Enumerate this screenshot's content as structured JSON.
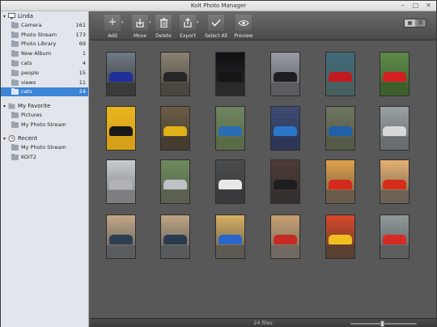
{
  "window": {
    "title": "Koit Photo Manager"
  },
  "sidebar": {
    "user": "Linda",
    "items": [
      {
        "label": "Camera",
        "count": "161"
      },
      {
        "label": "Photo Stream",
        "count": "173"
      },
      {
        "label": "Photo Library",
        "count": "69"
      },
      {
        "label": "New Album",
        "count": "1"
      },
      {
        "label": "cats",
        "count": "4"
      },
      {
        "label": "people",
        "count": "15"
      },
      {
        "label": "views",
        "count": "11"
      },
      {
        "label": "cats",
        "count": "24",
        "selected": true
      }
    ],
    "favorite_title": "My Favorite",
    "favorites": [
      {
        "label": "Pictures"
      },
      {
        "label": "My Photo Stream"
      }
    ],
    "recent_title": "Recent",
    "recent": [
      {
        "label": "My Photo Stream"
      },
      {
        "label": "KOIT2"
      }
    ]
  },
  "toolbar": {
    "add": "Add",
    "move": "Move",
    "delete": "Delete",
    "export": "Export",
    "select_all": "Select All",
    "preview": "Preview"
  },
  "status": {
    "file_count": "24 files",
    "zoom_level": 0.48
  },
  "photos": [
    {
      "sky": "#6f7a86",
      "car": "#1c2f9a",
      "road": "#3a3a3a"
    },
    {
      "sky": "#8a8272",
      "car": "#262626",
      "road": "#4c4640"
    },
    {
      "sky": "#101014",
      "car": "#151515",
      "road": "#2a2a2a"
    },
    {
      "sky": "#9a9ca4",
      "car": "#1e1e22",
      "road": "#5a5c62"
    },
    {
      "sky": "#3f6a78",
      "car": "#c21b1f",
      "road": "#486060"
    },
    {
      "sky": "#5f8a4a",
      "car": "#d41e22",
      "road": "#3e5f2c"
    },
    {
      "sky": "#e8b520",
      "car": "#1a1a1a",
      "road": "#d6a018"
    },
    {
      "sky": "#6b5c46",
      "car": "#e0b218",
      "road": "#463c30"
    },
    {
      "sky": "#6f8460",
      "car": "#2a6cb5",
      "road": "#5a6b48"
    },
    {
      "sky": "#3e4a72",
      "car": "#2b78c8",
      "road": "#2e3658"
    },
    {
      "sky": "#6d7460",
      "car": "#1f60a8",
      "road": "#545a48"
    },
    {
      "sky": "#9aa0a2",
      "car": "#d8d8d8",
      "road": "#6a6e70"
    },
    {
      "sky": "#c8ccce",
      "car": "#b0b2b4",
      "road": "#7c7e80"
    },
    {
      "sky": "#6d8a5c",
      "car": "#bfc2c4",
      "road": "#5c6050"
    },
    {
      "sky": "#4a4c4e",
      "car": "#e8e8e8",
      "road": "#3a3a3c"
    },
    {
      "sky": "#4c3a34",
      "car": "#1d1d1f",
      "road": "#363030"
    },
    {
      "sky": "#e0a04a",
      "car": "#d52a1e",
      "road": "#6a5c4a"
    },
    {
      "sky": "#e6b070",
      "car": "#d62c1c",
      "road": "#6c6256"
    },
    {
      "sky": "#c3a684",
      "car": "#2c3e52",
      "road": "#5a5c5e"
    },
    {
      "sky": "#bea482",
      "car": "#2a3a4e",
      "road": "#585a5c"
    },
    {
      "sky": "#d8b060",
      "car": "#2a66c8",
      "road": "#5c5a50"
    },
    {
      "sky": "#c9a070",
      "car": "#c52a24",
      "road": "#706a62"
    },
    {
      "sky": "#d8482a",
      "car": "#f0c020",
      "road": "#5a4030"
    },
    {
      "sky": "#8e9a98",
      "car": "#d82a24",
      "road": "#5c5e60"
    }
  ]
}
